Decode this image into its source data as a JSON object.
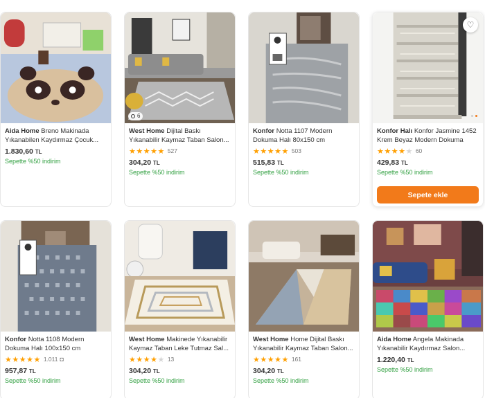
{
  "products": [
    {
      "brand": "Aida Home",
      "name": "Breno Makinada Yıkanabilen Kaydırmaz Çocuk...",
      "price": "1.830,60",
      "currency": "TL",
      "promo": "Sepette %50 indirim",
      "stars": "",
      "reviews": ""
    },
    {
      "brand": "West Home",
      "name": "Dijital Baskı Yıkanabilir Kaymaz Taban Salon...",
      "price": "304,20",
      "currency": "TL",
      "promo": "Sepette %50 indirim",
      "stars": "4.5",
      "reviews": "527",
      "image_count": "6"
    },
    {
      "brand": "Konfor",
      "name": "Notta 1107 Modern Dokuma Halı 80x150 cm",
      "price": "515,83",
      "currency": "TL",
      "promo": "Sepette %50 indirim",
      "stars": "4.5",
      "reviews": "503"
    },
    {
      "brand": "Konfor Halı",
      "name": "Konfor Jasmine 1452 Krem Beyaz Modern Dokuma Halı...",
      "price": "429,83",
      "currency": "TL",
      "promo": "Sepette %50 indirim",
      "stars": "4",
      "reviews": "60",
      "cart_button": "Sepete ekle"
    },
    {
      "brand": "Konfor",
      "name": "Notta 1108 Modern Dokuma Halı 100x150 cm",
      "price": "957,87",
      "currency": "TL",
      "promo": "Sepette %50 indirim",
      "stars": "4.5",
      "reviews": "1.011"
    },
    {
      "brand": "West Home",
      "name": "Makinede Yıkanabilir Kaymaz Taban Leke Tutmaz Sal...",
      "price": "304,20",
      "currency": "TL",
      "promo": "Sepette %50 indirim",
      "stars": "4",
      "reviews": "13"
    },
    {
      "brand": "West Home",
      "name": "Home Dijital Baskı Yıkanabilir Kaymaz Taban Salon...",
      "price": "304,20",
      "currency": "TL",
      "promo": "Sepette %50 indirim",
      "stars": "4.5",
      "reviews": "161"
    },
    {
      "brand": "Aida Home",
      "name": "Angela Makinada Yıkanabilir Kaydırmaz Salon...",
      "price": "1.220,40",
      "currency": "TL",
      "promo": "Sepette %50 indirim",
      "stars": "",
      "reviews": ""
    }
  ],
  "colors": {
    "accent": "#f27a1a",
    "promo": "#2e9e3e",
    "star": "#ff9f00"
  }
}
